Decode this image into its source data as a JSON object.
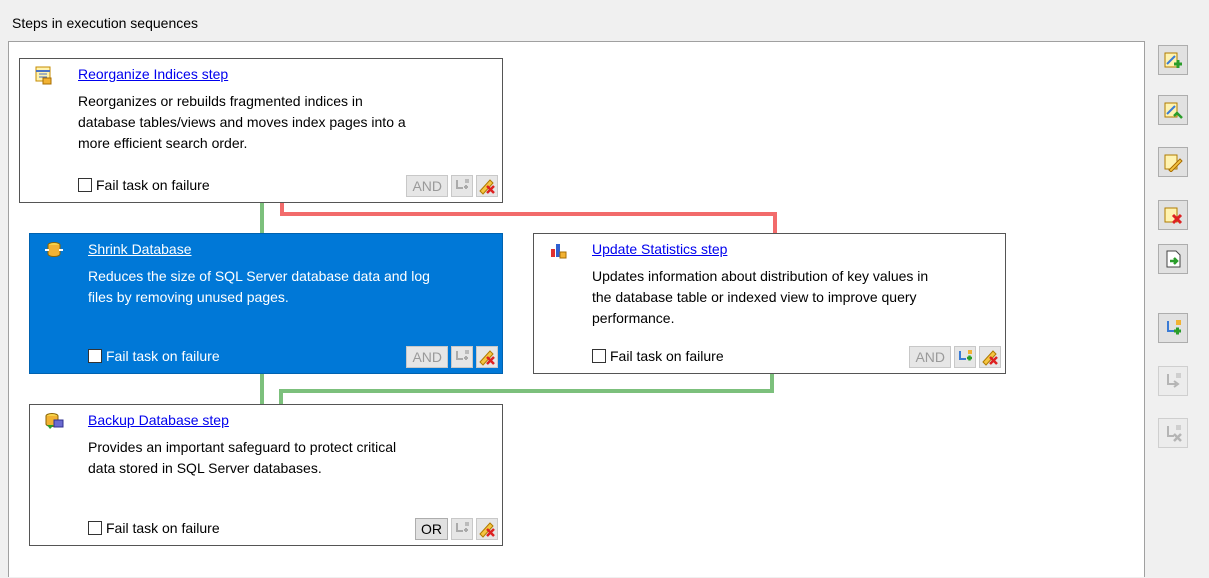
{
  "group_title": "Steps in execution sequences",
  "steps": [
    {
      "title": "Reorganize Indices step",
      "description_lines": [
        "Reorganizes or rebuilds fragmented indices in",
        "database tables/views and moves index pages into a",
        "more efficient search order."
      ],
      "fail_label": "Fail task on failure",
      "logic_label": "AND",
      "selected": false
    },
    {
      "title": "Shrink Database",
      "description_lines": [
        "Reduces the size of SQL Server database data and log",
        "files by removing unused pages."
      ],
      "fail_label": "Fail task on failure",
      "logic_label": "AND",
      "selected": true
    },
    {
      "title": "Update Statistics step",
      "description_lines": [
        "Updates information about distribution of key values in",
        "the database table or indexed view to improve query",
        "performance."
      ],
      "fail_label": "Fail task on failure",
      "logic_label": "AND",
      "selected": false
    },
    {
      "title": "Backup Database step",
      "description_lines": [
        "Provides an important safeguard to protect critical",
        "data stored in SQL Server databases."
      ],
      "fail_label": "Fail task on failure",
      "logic_label": "OR",
      "selected": false
    }
  ],
  "connector_colors": {
    "success": "#7cc07c",
    "failure": "#f26b6b"
  },
  "accent_color": "#0078d7",
  "toolbar_icons": [
    "add-step-icon",
    "edit-step-icon",
    "modify-step-icon",
    "delete-step-icon",
    "export-step-icon",
    "add-link-icon",
    "reroute-link-icon",
    "delete-link-icon"
  ]
}
